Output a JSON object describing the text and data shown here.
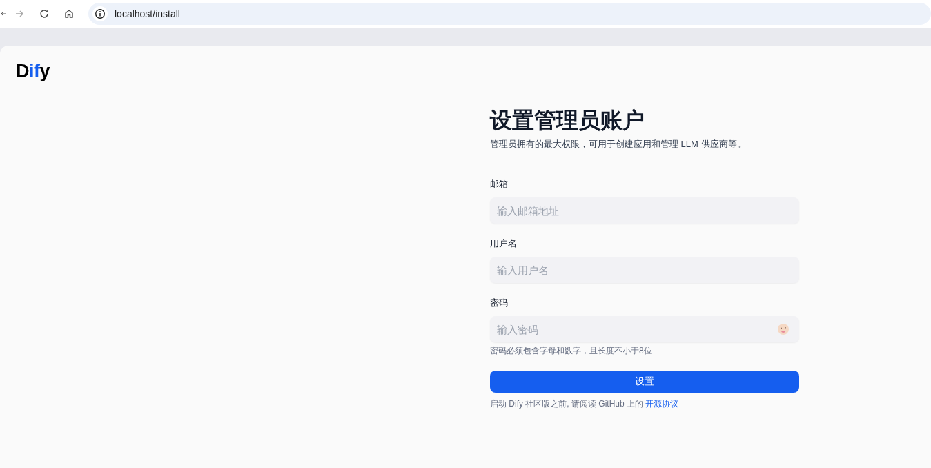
{
  "browser": {
    "nav": [
      {
        "kind": "back",
        "disabled": false
      },
      {
        "kind": "forward",
        "disabled": true
      },
      {
        "kind": "reload",
        "disabled": false
      },
      {
        "kind": "home",
        "disabled": false
      }
    ],
    "url": "localhost/install"
  },
  "logo": "Dify",
  "title": "设置管理员账户",
  "subtitle": "管理员拥有的最大权限，可用于创建应用和管理 LLM 供应商等。",
  "fields": [
    {
      "kind": "text",
      "label": "邮箱",
      "placeholder": "输入邮箱地址"
    },
    {
      "kind": "text",
      "label": "用户名",
      "placeholder": "输入用户名"
    },
    {
      "kind": "password",
      "label": "密码",
      "placeholder": "输入密码",
      "hint": "密码必须包含字母和数字，且长度不小于8位"
    }
  ],
  "submit": "设置",
  "footer": {
    "text": "启动 Dify 社区版之前, 请阅读 GitHub 上的 ",
    "link": "开源协议"
  }
}
